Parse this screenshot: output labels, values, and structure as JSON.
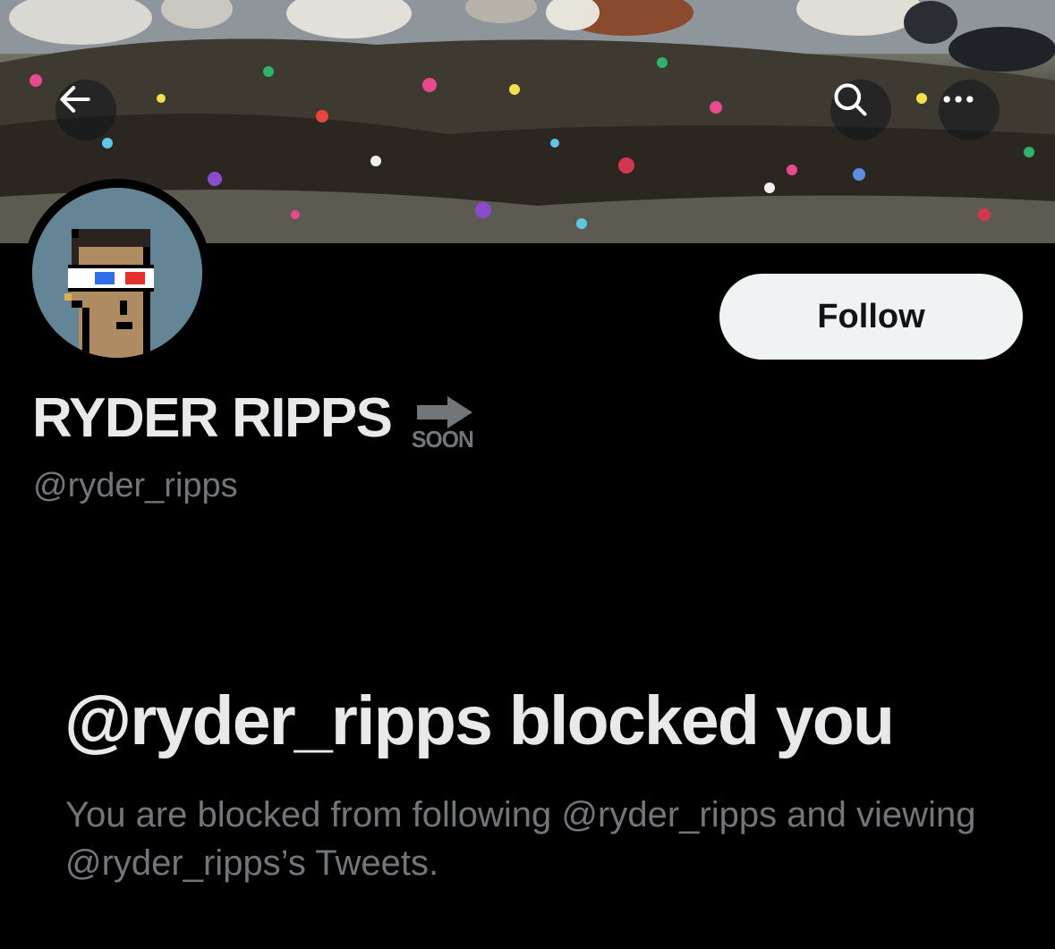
{
  "header": {
    "back_icon": "arrow-left-icon",
    "search_icon": "search-icon",
    "more_icon": "more-horizontal-icon"
  },
  "profile": {
    "display_name": "RYDER RIPPS",
    "emoji_label": "SOON",
    "emoji_name": "soon-arrow-emoji",
    "handle": "@ryder_ripps",
    "follow_label": "Follow"
  },
  "blocked": {
    "title": "@ryder_ripps blocked you",
    "description": "You are blocked from following @ryder_ripps and viewing @ryder_ripps’s Tweets."
  },
  "colors": {
    "background": "#000000",
    "primary_text": "#e7e9ea",
    "secondary_text": "#71767b",
    "follow_button_bg": "#eff3f4",
    "follow_button_text": "#0f1419",
    "avatar_bg": "#638596"
  }
}
